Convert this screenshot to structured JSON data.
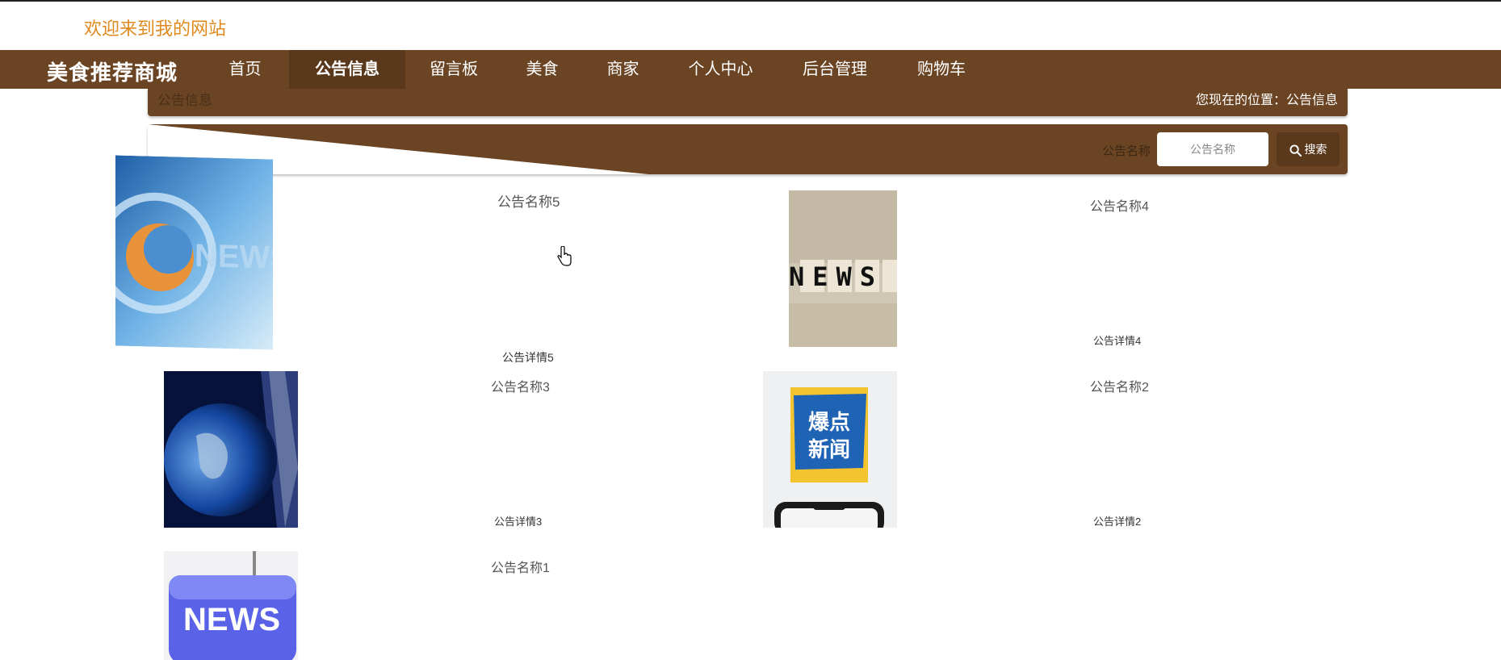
{
  "header": {
    "welcome": "欢迎来到我的网站"
  },
  "nav": {
    "brand": "美食推荐商城",
    "items": [
      {
        "label": "首页"
      },
      {
        "label": "公告信息",
        "active": true
      },
      {
        "label": "留言板"
      },
      {
        "label": "美食"
      },
      {
        "label": "商家"
      },
      {
        "label": "个人中心"
      },
      {
        "label": "后台管理"
      },
      {
        "label": "购物车"
      }
    ]
  },
  "breadcrumb": {
    "section": "公告信息",
    "location": "您现在的位置：公告信息"
  },
  "search": {
    "label": "公告名称",
    "placeholder": "公告名称",
    "button_label": "搜索",
    "button_icon": "search-icon"
  },
  "notices": [
    {
      "title": "公告名称5",
      "detail": "公告详情5",
      "image_text": "NEWS"
    },
    {
      "title": "公告名称4",
      "detail": "公告详情4",
      "image_text": "NEWS"
    },
    {
      "title": "公告名称3",
      "detail": "公告详情3",
      "image_text": ""
    },
    {
      "title": "公告名称2",
      "detail": "公告详情2",
      "image_text": "爆点新闻"
    },
    {
      "title": "公告名称1",
      "detail": "",
      "image_text": "NEWS"
    }
  ],
  "colors": {
    "primary": "#6b4423",
    "primary_dark": "#5a381c",
    "welcome": "#e08a1e"
  }
}
